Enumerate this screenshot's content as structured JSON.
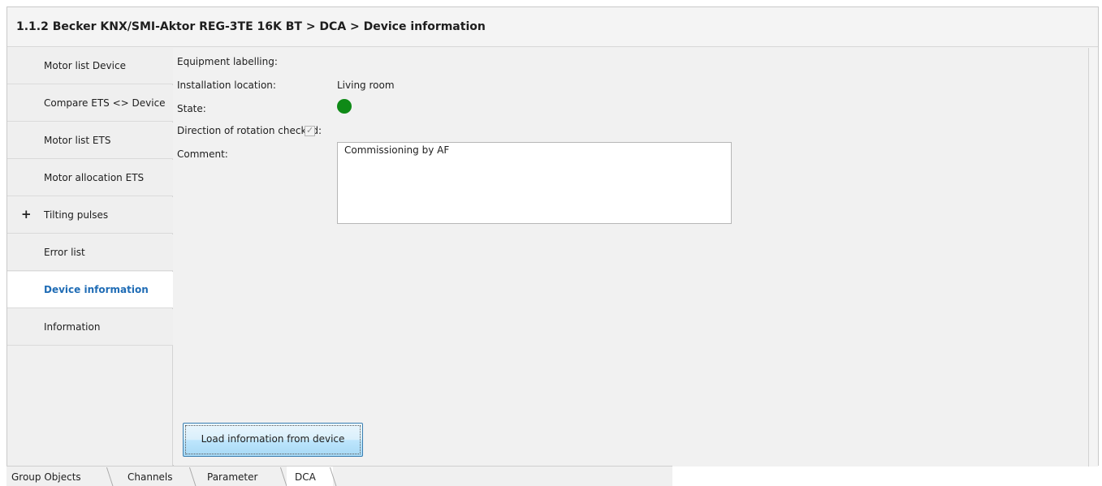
{
  "header": {
    "breadcrumb": "1.1.2 Becker KNX/SMI-Aktor REG-3TE 16K BT > DCA > Device information"
  },
  "sidebar": {
    "items": [
      {
        "label": "Motor list Device"
      },
      {
        "label": "Compare ETS <> Device"
      },
      {
        "label": "Motor list ETS"
      },
      {
        "label": "Motor allocation ETS"
      },
      {
        "label": "Tilting pulses",
        "expander": "+"
      },
      {
        "label": "Error list"
      },
      {
        "label": "Device information",
        "active": true
      },
      {
        "label": "Information"
      }
    ]
  },
  "device_info": {
    "equipment_labelling_label": "Equipment labelling:",
    "equipment_labelling_value": "",
    "installation_location_label": "Installation location:",
    "installation_location_value": "Living room",
    "state_label": "State:",
    "state_color": "#0f8a17",
    "direction_label": "Direction of rotation checked:",
    "direction_checked": true,
    "checkmark": "✓",
    "comment_label": "Comment:",
    "comment_value": "Commissioning by AF"
  },
  "actions": {
    "load_button": "Load information from device"
  },
  "bottom_tabs": [
    {
      "label": "Group Objects"
    },
    {
      "label": "Channels"
    },
    {
      "label": "Parameter"
    },
    {
      "label": "DCA",
      "active": true
    }
  ],
  "colors": {
    "accent_text": "#1f6cb5",
    "button_border": "#3c7fb1"
  }
}
